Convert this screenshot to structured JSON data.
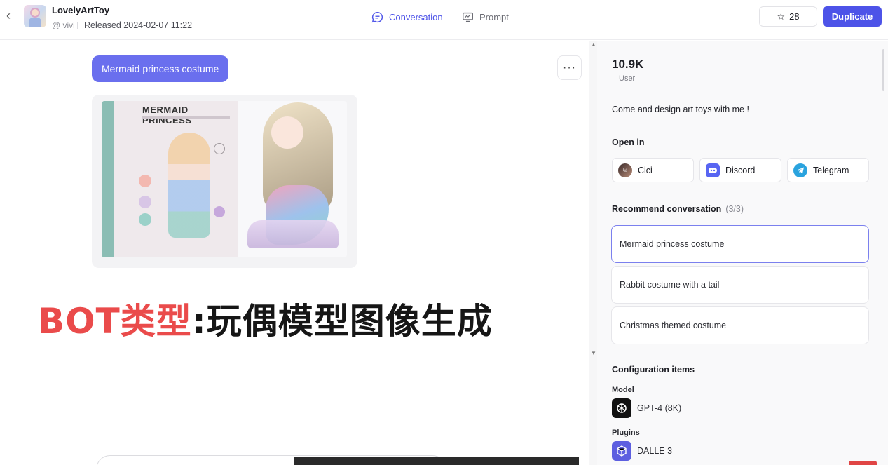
{
  "header": {
    "bot_name": "LovelyArtToy",
    "author": "@ vivi",
    "released": "Released 2024-02-07 11:22",
    "tabs": [
      {
        "label": "Conversation",
        "active": true
      },
      {
        "label": "Prompt",
        "active": false
      }
    ],
    "star_count": "28",
    "duplicate_label": "Duplicate"
  },
  "chat": {
    "user_message": "Mermaid princess costume",
    "more_label": "···",
    "image_title": "MERMAID PRINCESS",
    "overlay": {
      "red": "BOT类型",
      "black": ":玩偶模型图像生成"
    }
  },
  "panel": {
    "stat_value": "10.9K",
    "stat_label": "User",
    "description": "Come and design art toys with me !",
    "open_in_title": "Open in",
    "open_in": [
      {
        "label": "Cici",
        "icon": "cici-icon"
      },
      {
        "label": "Discord",
        "icon": "discord-icon"
      },
      {
        "label": "Telegram",
        "icon": "telegram-icon"
      }
    ],
    "recommend_title": "Recommend conversation",
    "recommend_count": "(3/3)",
    "recommend": [
      "Mermaid princess costume",
      "Rabbit costume with a tail",
      "Christmas themed costume"
    ],
    "config_title": "Configuration items",
    "model_label": "Model",
    "model_name": "GPT-4 (8K)",
    "plugins_label": "Plugins",
    "plugin_name": "DALLE 3"
  },
  "colors": {
    "accent": "#4d53e8",
    "user_bubble": "#6a6fee",
    "overlay_red": "#ea4b4b"
  }
}
